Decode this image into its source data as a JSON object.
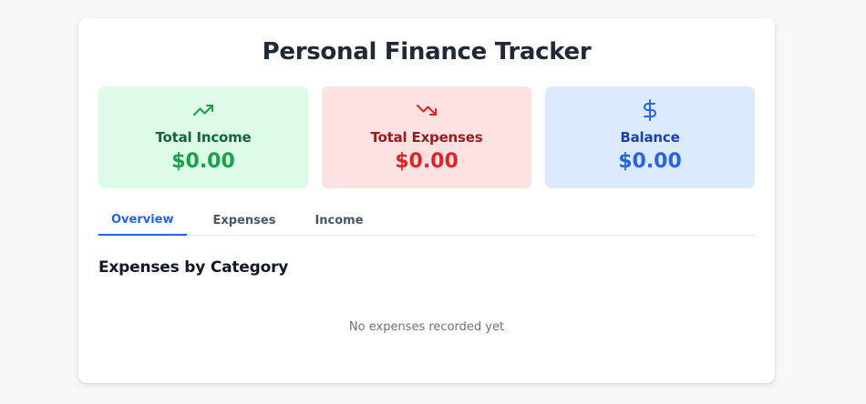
{
  "header": {
    "title": "Personal Finance Tracker"
  },
  "stats": [
    {
      "id": "income",
      "label": "Total Income",
      "value": "$0.00",
      "icon": "trending-up-icon",
      "color": "#16a34a"
    },
    {
      "id": "expenses",
      "label": "Total Expenses",
      "value": "$0.00",
      "icon": "trending-down-icon",
      "color": "#dc2626"
    },
    {
      "id": "balance",
      "label": "Balance",
      "value": "$0.00",
      "icon": "dollar-sign-icon",
      "color": "#2563eb"
    }
  ],
  "tabs": [
    {
      "label": "Overview",
      "active": true
    },
    {
      "label": "Expenses",
      "active": false
    },
    {
      "label": "Income",
      "active": false
    }
  ],
  "overview": {
    "section_title": "Expenses by Category",
    "empty_message": "No expenses recorded yet"
  }
}
